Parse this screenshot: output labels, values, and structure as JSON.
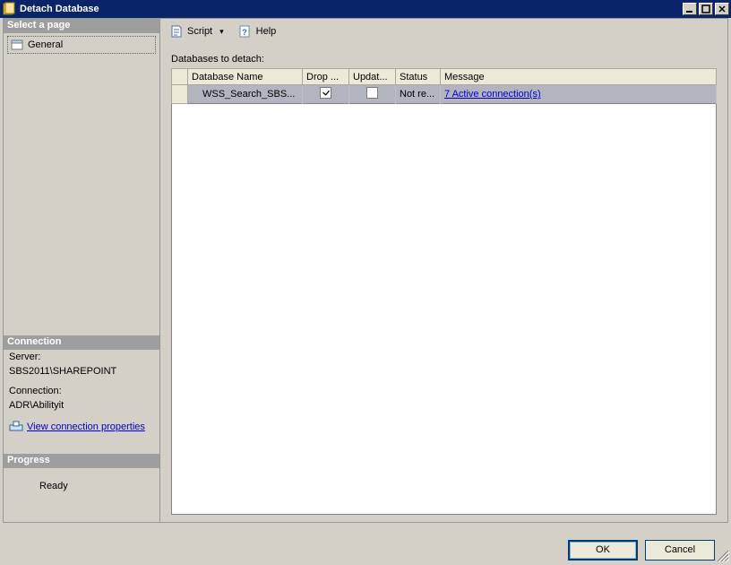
{
  "window": {
    "title": "Detach Database"
  },
  "left": {
    "select_page": "Select a page",
    "general": "General",
    "connection_header": "Connection",
    "server_label": "Server:",
    "server_value": "SBS2011\\SHAREPOINT",
    "connection_label": "Connection:",
    "connection_value": "ADR\\Abilityit",
    "view_conn_props": "View connection properties",
    "progress_header": "Progress",
    "progress_status": "Ready"
  },
  "toolbar": {
    "script": "Script",
    "help": "Help"
  },
  "main": {
    "grid_label": "Databases to detach:",
    "cols": {
      "name": "Database Name",
      "drop": "Drop ...",
      "update": "Updat...",
      "status": "Status",
      "message": "Message"
    },
    "row": {
      "name": "WSS_Search_SBS...",
      "drop_checked": true,
      "update_checked": false,
      "status": "Not re...",
      "message": "7 Active connection(s)"
    }
  },
  "footer": {
    "ok": "OK",
    "cancel": "Cancel"
  }
}
